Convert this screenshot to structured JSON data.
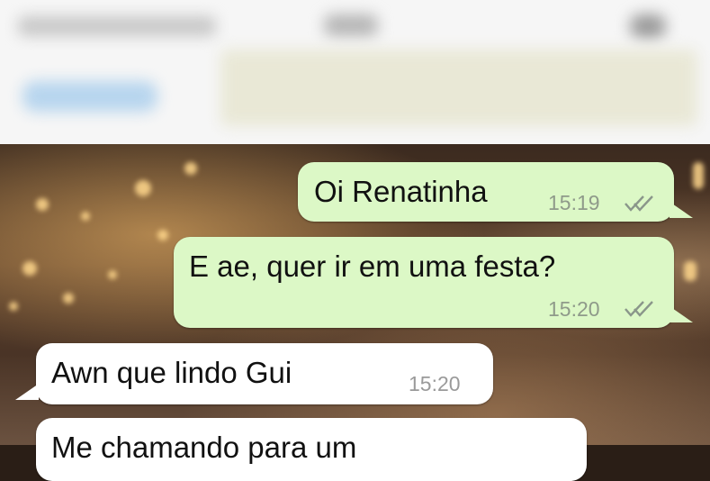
{
  "messages": [
    {
      "direction": "outgoing",
      "text": "Oi Renatinha",
      "time": "15:19",
      "status": "read-double-check"
    },
    {
      "direction": "outgoing",
      "text": "E ae, quer ir em uma festa?",
      "time": "15:20",
      "status": "read-double-check"
    },
    {
      "direction": "incoming",
      "text": "Awn que lindo Gui",
      "time": "15:20"
    },
    {
      "direction": "incoming",
      "text": "Me chamando para um"
    }
  ],
  "colors": {
    "outgoing_bubble": "#dcf8c6",
    "incoming_bubble": "#ffffff"
  }
}
